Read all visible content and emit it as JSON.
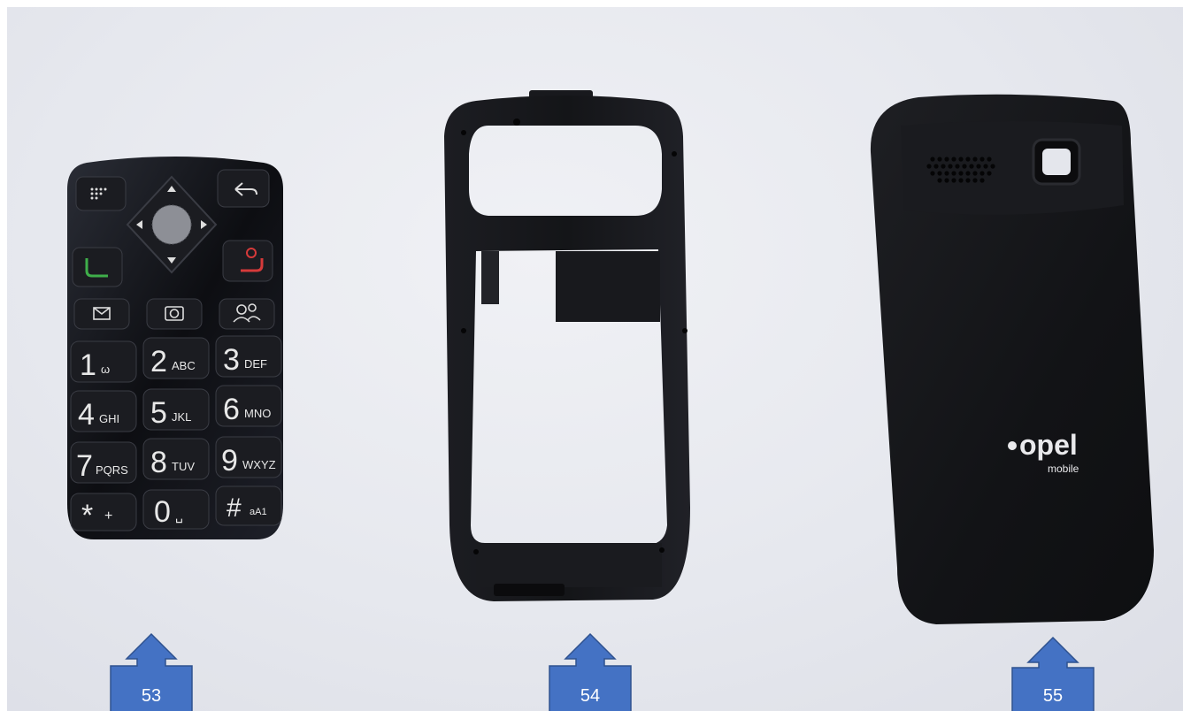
{
  "brand": {
    "logo_text": "opel",
    "logo_subtext": "mobile"
  },
  "keypad": {
    "digits": [
      {
        "digit": "1",
        "letters": "ω"
      },
      {
        "digit": "2",
        "letters": "ABC"
      },
      {
        "digit": "3",
        "letters": "DEF"
      },
      {
        "digit": "4",
        "letters": "GHI"
      },
      {
        "digit": "5",
        "letters": "JKL"
      },
      {
        "digit": "6",
        "letters": "MNO"
      },
      {
        "digit": "7",
        "letters": "PQRS"
      },
      {
        "digit": "8",
        "letters": "TUV"
      },
      {
        "digit": "9",
        "letters": "WXYZ"
      },
      {
        "digit": "*",
        "letters": "+"
      },
      {
        "digit": "0",
        "letters": "␣"
      },
      {
        "digit": "#",
        "letters": "aA1"
      }
    ]
  },
  "callouts": [
    {
      "label": "53"
    },
    {
      "label": "54"
    },
    {
      "label": "55"
    }
  ],
  "colors": {
    "callout_fill": "#4472c4",
    "callout_stroke": "#2f528f",
    "part_black": "#141416",
    "call_green": "#3fae4a",
    "end_red": "#d63a3a"
  }
}
